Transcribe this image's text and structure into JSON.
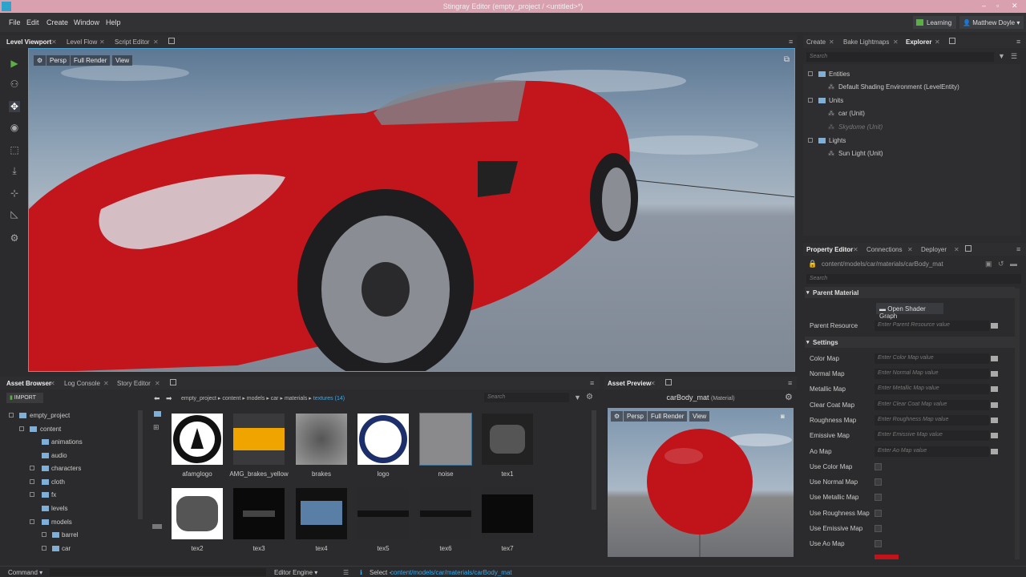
{
  "window": {
    "title": "Stingray Editor (empty_project / <untitled>*)"
  },
  "menu": [
    "File",
    "Edit",
    "Create",
    "Window",
    "Help"
  ],
  "topright": {
    "learning": "Learning",
    "user": "Matthew Doyle"
  },
  "viewport_tabs": [
    "Level Viewport",
    "Level Flow",
    "Script Editor"
  ],
  "viewport": {
    "settings_icon": "gear-icon",
    "persp": "Persp",
    "full_render": "Full Render",
    "view": "View"
  },
  "right_tabs": [
    "Create",
    "Bake Lightmaps",
    "Explorer"
  ],
  "explorer": {
    "search_placeholder": "Search",
    "entities": "Entities",
    "shading_env": "Default Shading Environment (LevelEntity)",
    "units": "Units",
    "car": "car (Unit)",
    "skydome": "Skydome (Unit)",
    "lights": "Lights",
    "sun": "Sun Light (Unit)"
  },
  "prop_tabs": [
    "Property Editor",
    "Connections",
    "Deployer"
  ],
  "property": {
    "path": "content/models/car/materials/carBody_mat",
    "search_placeholder": "Search",
    "parent_material": "Parent Material",
    "open_shader_graph": "Open Shader Graph",
    "parent_resource": "Parent Resource",
    "parent_resource_placeholder": "Enter Parent Resource value",
    "settings": "Settings",
    "maps": [
      {
        "label": "Color Map",
        "placeholder": "Enter Color Map value"
      },
      {
        "label": "Normal Map",
        "placeholder": "Enter Normal Map value"
      },
      {
        "label": "Metallic Map",
        "placeholder": "Enter Metallic Map value"
      },
      {
        "label": "Clear Coat Map",
        "placeholder": "Enter Clear Coat Map value"
      },
      {
        "label": "Roughness Map",
        "placeholder": "Enter Roughness Map value"
      },
      {
        "label": "Emissive Map",
        "placeholder": "Enter Emissive Map value"
      },
      {
        "label": "Ao Map",
        "placeholder": "Enter Ao Map value"
      }
    ],
    "checks": [
      "Use Color Map",
      "Use Normal Map",
      "Use Metallic Map",
      "Use Roughness Map",
      "Use Emissive Map",
      "Use Ao Map"
    ],
    "base_color_swatch": "#c0141a"
  },
  "bottom_tabs": [
    "Asset Browser",
    "Log Console",
    "Story Editor"
  ],
  "asset_browser": {
    "import": "IMPORT",
    "breadcrumb": [
      "empty_project",
      "content",
      "models",
      "car",
      "materials"
    ],
    "current": "textures (14)",
    "search_placeholder": "Search",
    "tree": [
      {
        "label": "empty_project",
        "level": 0
      },
      {
        "label": "content",
        "level": 1
      },
      {
        "label": "animations",
        "level": 2
      },
      {
        "label": "audio",
        "level": 2
      },
      {
        "label": "characters",
        "level": 2
      },
      {
        "label": "cloth",
        "level": 2
      },
      {
        "label": "fx",
        "level": 2
      },
      {
        "label": "levels",
        "level": 2
      },
      {
        "label": "models",
        "level": 2
      },
      {
        "label": "barrel",
        "level": 3
      },
      {
        "label": "car",
        "level": 3
      }
    ],
    "items": [
      "afamglogo",
      "AMG_brakes_yellow",
      "brakes",
      "logo",
      "noise",
      "tex1",
      "tex2",
      "tex3",
      "tex4",
      "tex5",
      "tex6",
      "tex7"
    ]
  },
  "asset_preview": {
    "tab": "Asset Preview",
    "name": "carBody_mat",
    "type": "(Material)",
    "persp": "Persp",
    "full_render": "Full Render",
    "view": "View"
  },
  "statusbar": {
    "command": "Command",
    "engine": "Editor Engine",
    "select": "Select -",
    "select_path": "content/models/car/materials/carBody_mat"
  },
  "colors": {
    "accent": "#4aa5d8",
    "title_bar": "#d9a0b0",
    "car_red": "#c0141a",
    "link": "#3fa9e8"
  }
}
